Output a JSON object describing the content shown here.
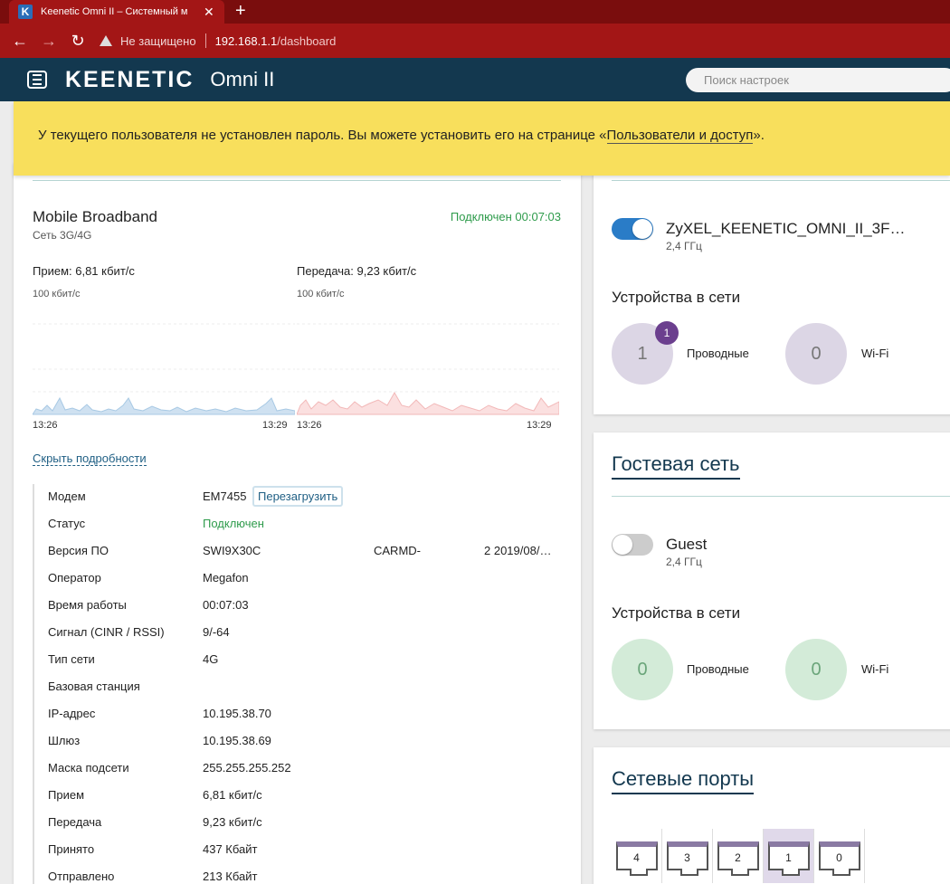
{
  "browser": {
    "tab_title": "Keenetic Omni II – Системный м",
    "tab_favicon": "K",
    "security_label": "Не защищено",
    "url_host": "192.168.1.1",
    "url_path": "/dashboard"
  },
  "header": {
    "brand": "KEENETIC",
    "model": "Omni II",
    "search_placeholder": "Поиск настроек"
  },
  "banner": {
    "text_before": "У текущего пользователя не установлен пароль. Вы можете установить его на странице «",
    "link": "Пользователи и доступ",
    "text_after": "»."
  },
  "broadband": {
    "title": "Mobile Broadband",
    "subtitle": "Сеть 3G/4G",
    "status": "Подключен 00:07:03",
    "rx_rate": "Прием: 6,81 кбит/с",
    "tx_rate": "Передача: 9,23 кбит/с",
    "scale": "100 кбит/с",
    "time_start": "13:26",
    "time_end": "13:29",
    "hide_details": "Скрыть подробности",
    "reboot_label": "Перезагрузить",
    "firmware_part2": "CARMD-",
    "firmware_part3": "2 2019/08/…",
    "details": [
      {
        "key": "Модем",
        "value": "EM7455"
      },
      {
        "key": "Статус",
        "value": "Подключен"
      },
      {
        "key": "Версия ПО",
        "value": "SWI9X30C"
      },
      {
        "key": "Оператор",
        "value": "Megafon"
      },
      {
        "key": "Время работы",
        "value": "00:07:03"
      },
      {
        "key": "Сигнал (CINR / RSSI)",
        "value": "9/-64"
      },
      {
        "key": "Тип сети",
        "value": "4G"
      },
      {
        "key": "Базовая станция",
        "value": ""
      },
      {
        "key": "IP-адрес",
        "value": "10.195.38.70"
      },
      {
        "key": "Шлюз",
        "value": "10.195.38.69"
      },
      {
        "key": "Маска подсети",
        "value": "255.255.255.252"
      },
      {
        "key": "Прием",
        "value": "6,81 кбит/с"
      },
      {
        "key": "Передача",
        "value": "9,23 кбит/с"
      },
      {
        "key": "Принято",
        "value": "437 Кбайт"
      },
      {
        "key": "Отправлено",
        "value": "213 Кбайт"
      }
    ]
  },
  "home_wifi": {
    "ssid": "ZyXEL_KEENETIC_OMNI_II_3F…",
    "band": "2,4 ГГц",
    "enabled": true,
    "devices_title": "Устройства в сети",
    "wired_count": "1",
    "wired_badge": "1",
    "wired_label": "Проводные",
    "wifi_count": "0",
    "wifi_label": "Wi-Fi"
  },
  "guest": {
    "title": "Гостевая сеть",
    "ssid": "Guest",
    "band": "2,4 ГГц",
    "enabled": false,
    "devices_title": "Устройства в сети",
    "wired_count": "0",
    "wired_label": "Проводные",
    "wifi_count": "0",
    "wifi_label": "Wi-Fi"
  },
  "ports": {
    "title": "Сетевые порты",
    "items": [
      "4",
      "3",
      "2",
      "1",
      "0"
    ],
    "active": "1"
  },
  "colors": {
    "header_bg": "#13384f",
    "banner_bg": "#f8df5c",
    "status_green": "#2e9b4b",
    "toggle_on": "#2a7cc7",
    "badge_purple": "#6b3f8e",
    "rx_graph": "#a8c9e4",
    "tx_graph": "#f2b8b8"
  }
}
